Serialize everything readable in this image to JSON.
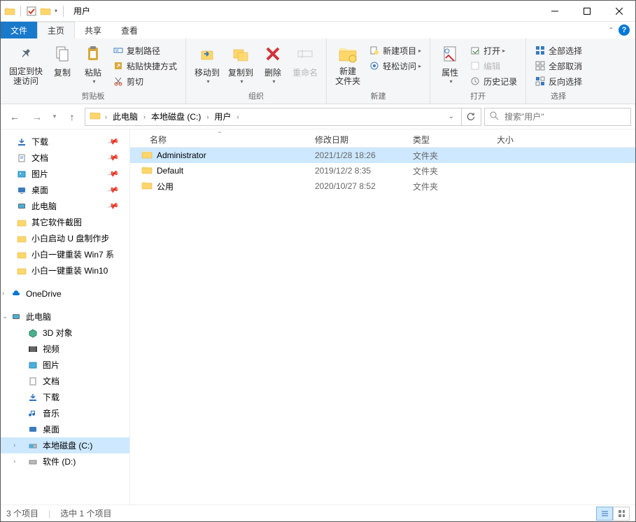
{
  "title": "用户",
  "menu": {
    "file": "文件",
    "home": "主页",
    "share": "共享",
    "view": "查看"
  },
  "ribbon": {
    "pin": "固定到快\n速访问",
    "copy": "复制",
    "paste": "粘贴",
    "copy_path": "复制路径",
    "paste_shortcut": "粘贴快捷方式",
    "cut": "剪切",
    "group_clipboard": "剪贴板",
    "move_to": "移动到",
    "copy_to": "复制到",
    "delete": "删除",
    "rename": "重命名",
    "group_organize": "组织",
    "new_folder": "新建\n文件夹",
    "new_item": "新建项目",
    "easy_access": "轻松访问",
    "group_new": "新建",
    "properties": "属性",
    "open": "打开",
    "edit": "编辑",
    "history": "历史记录",
    "group_open": "打开",
    "select_all": "全部选择",
    "select_none": "全部取消",
    "invert_selection": "反向选择",
    "group_select": "选择"
  },
  "breadcrumb": {
    "root": "此电脑",
    "drive": "本地磁盘 (C:)",
    "folder": "用户"
  },
  "search_placeholder": "搜索\"用户\"",
  "sidebar": {
    "downloads": "下载",
    "documents": "文档",
    "pictures": "图片",
    "desktop": "桌面",
    "this_pc": "此电脑",
    "custom1": "其它软件截图",
    "custom2": "小白启动 U 盘制作步",
    "custom3": "小白一键重装 Win7 系",
    "custom4": "小白一键重装 Win10",
    "onedrive": "OneDrive",
    "this_pc_root": "此电脑",
    "objects_3d": "3D 对象",
    "videos": "视频",
    "pictures2": "图片",
    "documents2": "文档",
    "downloads2": "下载",
    "music": "音乐",
    "desktop2": "桌面",
    "drive_c": "本地磁盘 (C:)",
    "drive_d": "软件 (D:)"
  },
  "columns": {
    "name": "名称",
    "date": "修改日期",
    "type": "类型",
    "size": "大小"
  },
  "rows": [
    {
      "name": "Administrator",
      "date": "2021/1/28 18:26",
      "type": "文件夹",
      "size": "",
      "selected": true
    },
    {
      "name": "Default",
      "date": "2019/12/2 8:35",
      "type": "文件夹",
      "size": "",
      "selected": false
    },
    {
      "name": "公用",
      "date": "2020/10/27 8:52",
      "type": "文件夹",
      "size": "",
      "selected": false
    }
  ],
  "status": {
    "item_count": "3 个项目",
    "selected": "选中 1 个项目"
  }
}
